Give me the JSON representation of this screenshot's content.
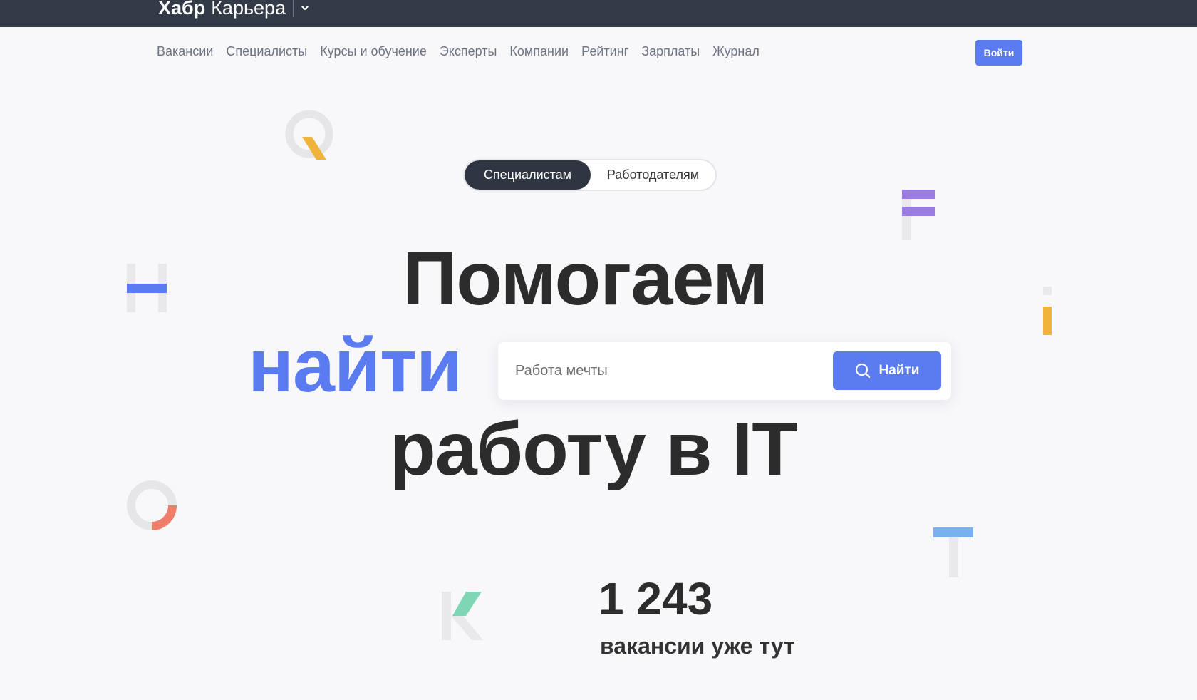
{
  "header": {
    "brand_bold": "Хабр",
    "brand_regular": "Карьера"
  },
  "nav": {
    "items": [
      "Вакансии",
      "Специалисты",
      "Курсы и обучение",
      "Эксперты",
      "Компании",
      "Рейтинг",
      "Зарплаты",
      "Журнал"
    ],
    "login_label": "Войти"
  },
  "audience_toggle": {
    "active": "Специалистам",
    "inactive": "Работодателям"
  },
  "hero": {
    "line1": "Помогаем",
    "line2": "найти",
    "line3": "работу в IT"
  },
  "search": {
    "placeholder": "Работа мечты",
    "value": "",
    "button_label": "Найти"
  },
  "stats": {
    "count": "1 243",
    "label": "вакансии уже тут"
  },
  "colors": {
    "accent": "#5a7cf0",
    "topbar": "#333a48",
    "toggle_active": "#2f3541",
    "background": "#f8f8fb",
    "deco_yellow": "#f0b43a",
    "deco_purple": "#9b7ce4",
    "deco_coral": "#f07d6a",
    "deco_green": "#7fd6b4",
    "deco_lightblue": "#7ab0ee"
  }
}
